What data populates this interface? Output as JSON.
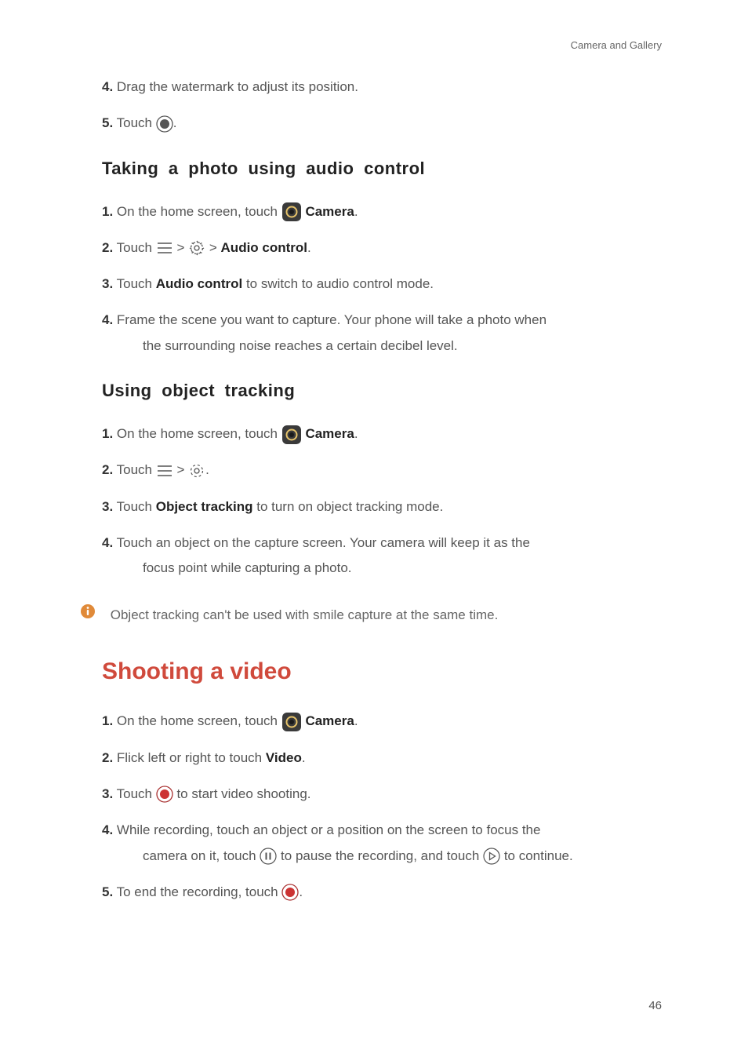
{
  "running_header": "Camera and Gallery",
  "intro_steps": {
    "s4": {
      "num": "4.",
      "text": "Drag the watermark to adjust its position."
    },
    "s5": {
      "num": "5.",
      "text_a": "Touch",
      "text_b": "."
    }
  },
  "sub1": {
    "title_w1": "Taking",
    "title_w2": "a",
    "title_w3": "photo",
    "title_w4": "using",
    "title_w5": "audio",
    "title_w6": "control",
    "steps": {
      "s1": {
        "num": "1.",
        "a": "On the home screen, touch",
        "camera": "Camera",
        "b": "."
      },
      "s2": {
        "num": "2.",
        "a": "Touch",
        "b": ">",
        "c": ">",
        "bold": "Audio control",
        "d": "."
      },
      "s3": {
        "num": "3.",
        "a": "Touch",
        "bold": "Audio control",
        "b": "to switch to audio control mode."
      },
      "s4": {
        "num": "4.",
        "a": "Frame the scene you want to capture. Your phone will take a photo when",
        "b": "the surrounding noise reaches a certain decibel level."
      }
    }
  },
  "sub2": {
    "title_w1": "Using",
    "title_w2": "object",
    "title_w3": "tracking",
    "steps": {
      "s1": {
        "num": "1.",
        "a": "On the home screen, touch",
        "camera": "Camera",
        "b": "."
      },
      "s2": {
        "num": "2.",
        "a": "Touch",
        "b": ">",
        "c": "."
      },
      "s3": {
        "num": "3.",
        "a": "Touch",
        "bold": "Object tracking",
        "b": "to turn on object tracking mode."
      },
      "s4": {
        "num": "4.",
        "a": "Touch an object on the capture screen. Your camera will keep it as the",
        "b": "focus point while capturing a photo."
      }
    },
    "info": "Object tracking can't be used with smile capture at the same time."
  },
  "section": {
    "title": "Shooting a video",
    "steps": {
      "s1": {
        "num": "1.",
        "a": "On the home screen, touch",
        "camera": "Camera",
        "b": "."
      },
      "s2": {
        "num": "2.",
        "a": "Flick left or right to touch",
        "bold": "Video",
        "b": "."
      },
      "s3": {
        "num": "3.",
        "a": "Touch",
        "b": "to start video shooting."
      },
      "s4": {
        "num": "4.",
        "a": "While recording, touch an object or a position on the screen to focus the",
        "b": "camera on it, touch",
        "c": "to pause the recording, and touch",
        "d": "to continue."
      },
      "s5": {
        "num": "5.",
        "a": "To end the recording, touch",
        "b": "."
      }
    }
  },
  "page_number": "46"
}
